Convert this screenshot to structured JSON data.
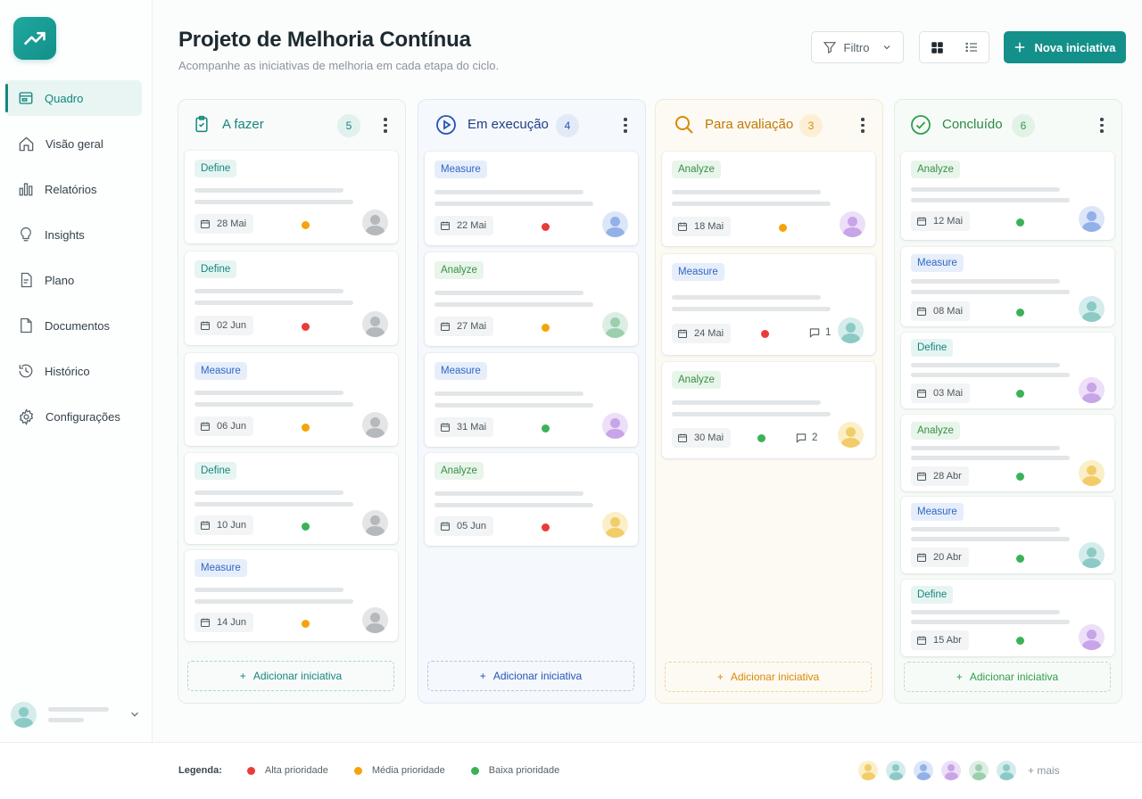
{
  "header": {
    "title": "Projeto de Melhoria Contínua",
    "subtitle": "Acompanhe as iniciativas de melhoria em cada etapa do ciclo.",
    "filter_label": "Filtro",
    "new_button_label": "Nova iniciativa"
  },
  "sidebar": {
    "items": [
      {
        "label": "Quadro",
        "icon": "board-icon",
        "active": true
      },
      {
        "label": "Visão geral",
        "icon": "home-icon"
      },
      {
        "label": "Relatórios",
        "icon": "bar-chart-icon"
      },
      {
        "label": "Insights",
        "icon": "lightbulb-icon"
      },
      {
        "label": "Plano",
        "icon": "document-icon"
      },
      {
        "label": "Documentos",
        "icon": "file-icon"
      },
      {
        "label": "Histórico",
        "icon": "history-icon"
      },
      {
        "label": "Configurações",
        "icon": "gear-icon"
      }
    ]
  },
  "columns": [
    {
      "title": "A fazer",
      "count": "5",
      "add_label": "Adicionar iniciativa",
      "cards": [
        {
          "tag": "Define",
          "date": "28 Mai",
          "priority": "media"
        },
        {
          "tag": "Define",
          "date": "02 Jun",
          "priority": "alta"
        },
        {
          "tag": "Measure",
          "date": "06 Jun",
          "priority": "media"
        },
        {
          "tag": "Define",
          "date": "10 Jun",
          "priority": "baixa"
        },
        {
          "tag": "Measure",
          "date": "14 Jun",
          "priority": "media"
        }
      ]
    },
    {
      "title": "Em execução",
      "count": "4",
      "add_label": "Adicionar iniciativa",
      "cards": [
        {
          "tag": "Measure",
          "date": "22 Mai",
          "priority": "alta"
        },
        {
          "tag": "Analyze",
          "date": "27 Mai",
          "priority": "media"
        },
        {
          "tag": "Measure",
          "date": "31 Mai",
          "priority": "baixa"
        },
        {
          "tag": "Analyze",
          "date": "05 Jun",
          "priority": "alta"
        }
      ]
    },
    {
      "title": "Para avaliação",
      "count": "3",
      "add_label": "Adicionar iniciativa",
      "cards": [
        {
          "tag": "Analyze",
          "date": "18 Mai",
          "priority": "media"
        },
        {
          "tag": "Measure",
          "date": "24 Mai",
          "priority": "alta",
          "comments": "1"
        },
        {
          "tag": "Analyze",
          "date": "30 Mai",
          "priority": "baixa",
          "comments": "2"
        }
      ]
    },
    {
      "title": "Concluído",
      "count": "6",
      "add_label": "Adicionar iniciativa",
      "cards": [
        {
          "tag": "Analyze",
          "date": "12 Mai",
          "priority": "baixa"
        },
        {
          "tag": "Measure",
          "date": "08 Mai",
          "priority": "baixa"
        },
        {
          "tag": "Define",
          "date": "03 Mai",
          "priority": "baixa"
        },
        {
          "tag": "Analyze",
          "date": "28 Abr",
          "priority": "baixa"
        },
        {
          "tag": "Measure",
          "date": "20 Abr",
          "priority": "baixa"
        },
        {
          "tag": "Define",
          "date": "15 Abr",
          "priority": "baixa"
        }
      ]
    }
  ],
  "legend": {
    "label": "Legenda:",
    "alta": "Alta prioridade",
    "media": "Média prioridade",
    "baixa": "Baixa prioridade"
  },
  "team": {
    "more_label": "+ mais"
  },
  "colors": {
    "accent": "#14908a",
    "alta": "#ea3b3b",
    "media": "#f4a40a",
    "baixa": "#3bb256",
    "todo": "#17857e",
    "in_progress": "#2454b8",
    "review": "#d98a06",
    "done": "#2f9e4c"
  }
}
